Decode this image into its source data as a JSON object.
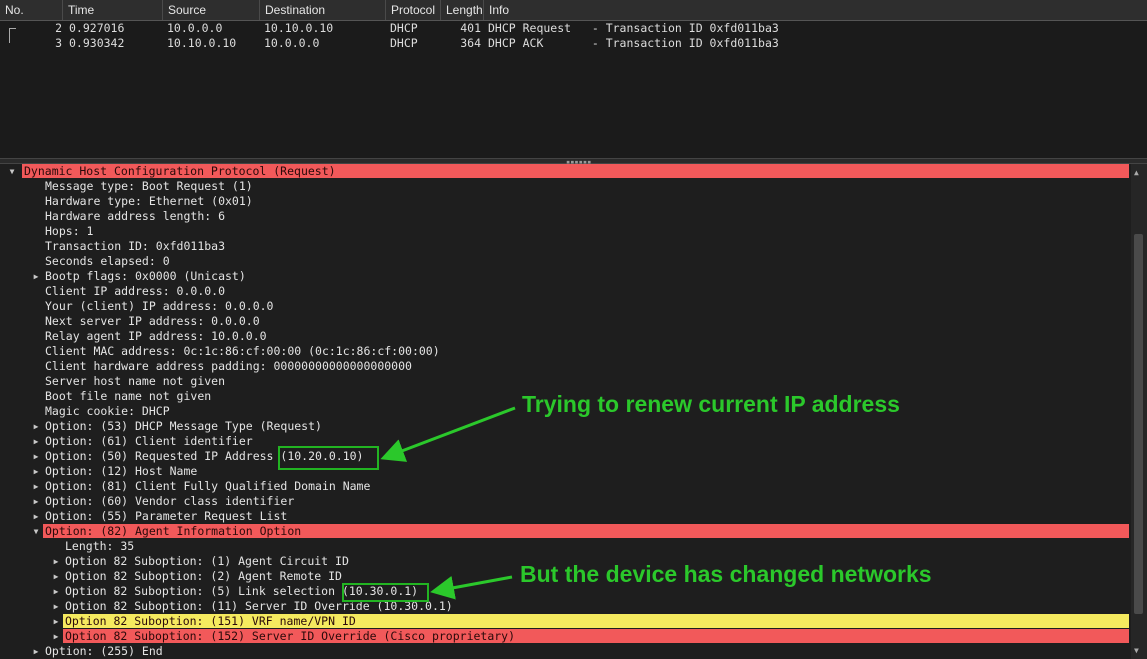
{
  "columns": {
    "no": "No.",
    "time": "Time",
    "source": "Source",
    "destination": "Destination",
    "protocol": "Protocol",
    "length": "Length",
    "info": "Info"
  },
  "packets": [
    {
      "no": "2",
      "time": "0.927016",
      "source": "10.0.0.0",
      "destination": "10.10.0.10",
      "protocol": "DHCP",
      "length": "401",
      "info": "DHCP Request   - Transaction ID 0xfd011ba3"
    },
    {
      "no": "3",
      "time": "0.930342",
      "source": "10.10.0.10",
      "destination": "10.0.0.0",
      "protocol": "DHCP",
      "length": "364",
      "info": "DHCP ACK       - Transaction ID 0xfd011ba3"
    }
  ],
  "tree": [
    {
      "text": "Dynamic Host Configuration Protocol (Request)",
      "arrow": "down",
      "highlight": "red"
    },
    {
      "text": "Message type: Boot Request (1)"
    },
    {
      "text": "Hardware type: Ethernet (0x01)"
    },
    {
      "text": "Hardware address length: 6"
    },
    {
      "text": "Hops: 1"
    },
    {
      "text": "Transaction ID: 0xfd011ba3"
    },
    {
      "text": "Seconds elapsed: 0"
    },
    {
      "text": "Bootp flags: 0x0000 (Unicast)",
      "arrow": "right"
    },
    {
      "text": "Client IP address: 0.0.0.0"
    },
    {
      "text": "Your (client) IP address: 0.0.0.0"
    },
    {
      "text": "Next server IP address: 0.0.0.0"
    },
    {
      "text": "Relay agent IP address: 10.0.0.0"
    },
    {
      "text": "Client MAC address: 0c:1c:86:cf:00:00 (0c:1c:86:cf:00:00)"
    },
    {
      "text": "Client hardware address padding: 00000000000000000000"
    },
    {
      "text": "Server host name not given"
    },
    {
      "text": "Boot file name not given"
    },
    {
      "text": "Magic cookie: DHCP"
    },
    {
      "text": "Option: (53) DHCP Message Type (Request)",
      "arrow": "right"
    },
    {
      "text": "Option: (61) Client identifier",
      "arrow": "right"
    },
    {
      "text": "Option: (50) Requested IP Address (10.20.0.10)",
      "arrow": "right"
    },
    {
      "text": "Option: (12) Host Name",
      "arrow": "right"
    },
    {
      "text": "Option: (81) Client Fully Qualified Domain Name",
      "arrow": "right"
    },
    {
      "text": "Option: (60) Vendor class identifier",
      "arrow": "right"
    },
    {
      "text": "Option: (55) Parameter Request List",
      "arrow": "right"
    },
    {
      "text": "Option: (82) Agent Information Option",
      "arrow": "down",
      "highlight": "red"
    },
    {
      "text": "Length: 35",
      "level": 2
    },
    {
      "text": "Option 82 Suboption: (1) Agent Circuit ID",
      "arrow": "right",
      "level": 2
    },
    {
      "text": "Option 82 Suboption: (2) Agent Remote ID",
      "arrow": "right",
      "level": 2
    },
    {
      "text": "Option 82 Suboption: (5) Link selection (10.30.0.1)",
      "arrow": "right",
      "level": 2
    },
    {
      "text": "Option 82 Suboption: (11) Server ID Override (10.30.0.1)",
      "arrow": "right",
      "level": 2
    },
    {
      "text": "Option 82 Suboption: (151) VRF name/VPN ID",
      "arrow": "right",
      "level": 2,
      "highlight": "yellow"
    },
    {
      "text": "Option 82 Suboption: (152) Server ID Override (Cisco proprietary)",
      "arrow": "right",
      "level": 2,
      "highlight": "red"
    },
    {
      "text": "Option: (255) End",
      "arrow": "right"
    }
  ],
  "annotations": {
    "renew": "Trying to renew current IP address",
    "changed": "But the device has changed networks"
  },
  "colors": {
    "highlight_red": "#f2595a",
    "highlight_yellow": "#f5ea5f",
    "annotation_green": "#2bc82b"
  }
}
